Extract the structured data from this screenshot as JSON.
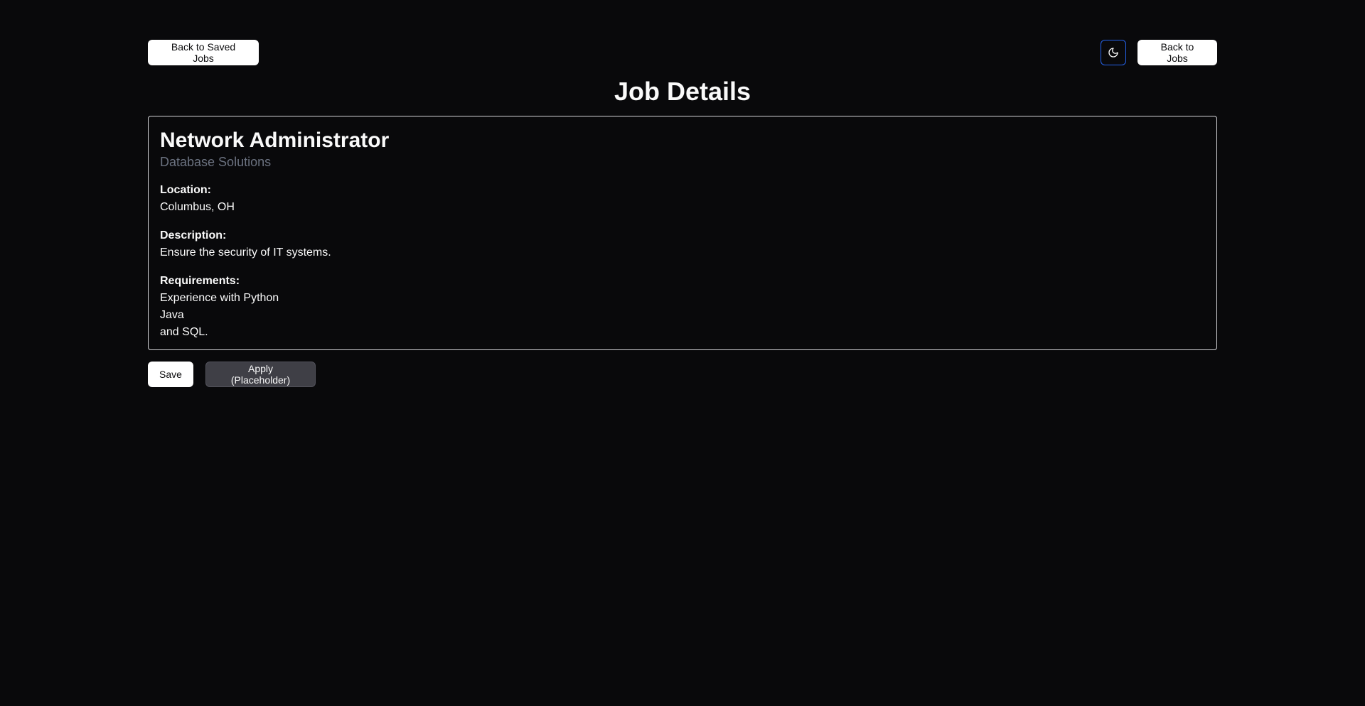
{
  "header": {
    "back_to_saved_label": "Back to Saved Jobs",
    "back_to_jobs_label": "Back to Jobs",
    "theme_toggle_icon": "moon-icon"
  },
  "page": {
    "title": "Job Details"
  },
  "job": {
    "title": "Network Administrator",
    "company": "Database Solutions",
    "location_label": "Location:",
    "location": "Columbus, OH",
    "description_label": "Description:",
    "description": "Ensure the security of IT systems.",
    "requirements_label": "Requirements:",
    "requirements": [
      "Experience with Python",
      "Java",
      "and SQL."
    ]
  },
  "actions": {
    "save_label": "Save",
    "apply_label": "Apply (Placeholder)"
  },
  "colors": {
    "background": "#09090b",
    "theme_toggle_border": "#2563eb",
    "company_text": "#6b7280"
  }
}
